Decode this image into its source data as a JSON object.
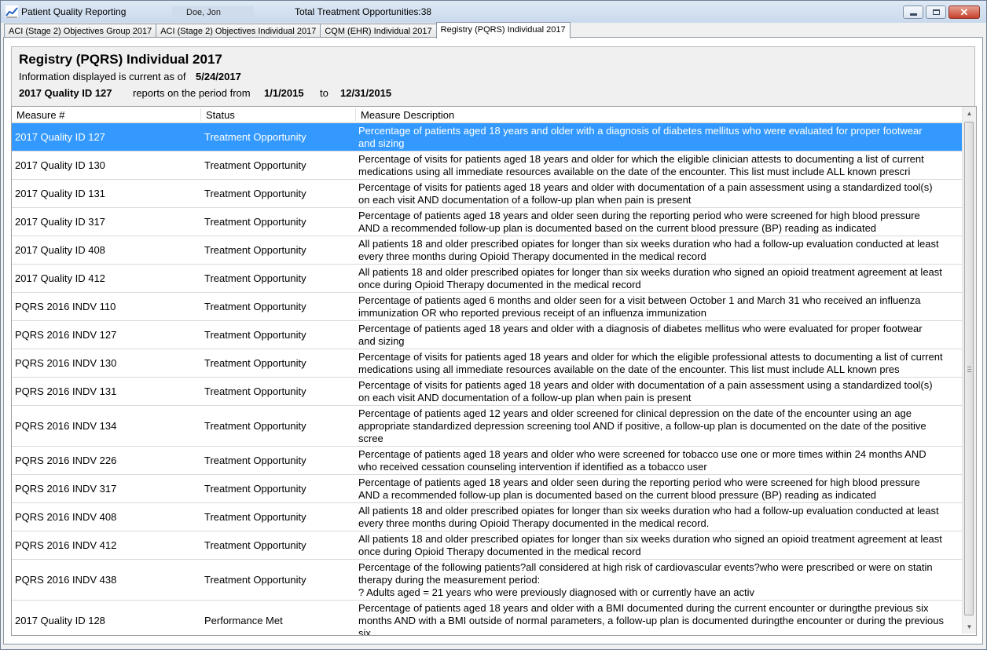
{
  "window": {
    "title": "Patient Quality Reporting",
    "patient_name": "Doe, Jon",
    "opportunities": "Total Treatment Opportunities:38"
  },
  "tabs": [
    {
      "label": "ACI (Stage 2) Objectives Group 2017",
      "active": false
    },
    {
      "label": "ACI (Stage 2) Objectives Individual 2017",
      "active": false
    },
    {
      "label": "CQM (EHR) Individual 2017",
      "active": false
    },
    {
      "label": "Registry (PQRS) Individual 2017",
      "active": true
    }
  ],
  "header": {
    "title": "Registry (PQRS) Individual 2017",
    "asof_label": "Information displayed is current as of",
    "asof_date": "5/24/2017",
    "selected_measure": "2017 Quality ID 127",
    "period_label": "reports on the period from",
    "period_from": "1/1/2015",
    "period_to_label": "to",
    "period_to": "12/31/2015"
  },
  "grid": {
    "columns": [
      "Measure #",
      "Status",
      "Measure Description"
    ],
    "rows": [
      {
        "measure": "2017 Quality ID 127",
        "status": "Treatment Opportunity",
        "selected": true,
        "desc": [
          "Percentage of patients aged 18 years and older with a diagnosis of diabetes mellitus who were evaluated for proper footwear",
          "and sizing"
        ]
      },
      {
        "measure": "2017 Quality ID 130",
        "status": "Treatment Opportunity",
        "desc": [
          "Percentage of visits for patients aged 18 years and older for which the eligible clinician attests to documenting a list of current",
          "medications using all immediate resources available on the date of the encounter. This list must include ALL known prescri"
        ]
      },
      {
        "measure": "2017 Quality ID 131",
        "status": "Treatment Opportunity",
        "desc": [
          "Percentage of visits for patients aged 18 years and older with documentation of a pain assessment using a standardized tool(s)",
          "on each visit AND documentation of a follow-up plan when pain is present"
        ]
      },
      {
        "measure": "2017 Quality ID 317",
        "status": "Treatment Opportunity",
        "desc": [
          "Percentage of patients aged 18 years and older seen during the reporting period who were screened for high blood pressure",
          "AND a recommended follow-up plan is documented based on the current blood pressure (BP) reading as indicated"
        ]
      },
      {
        "measure": "2017 Quality ID 408",
        "status": "Treatment Opportunity",
        "desc": [
          "All patients 18 and older prescribed opiates for longer than six weeks duration who had a follow-up evaluation conducted at least",
          "every three months during Opioid Therapy documented in the medical record"
        ]
      },
      {
        "measure": "2017 Quality ID 412",
        "status": "Treatment Opportunity",
        "desc": [
          "All patients 18 and older prescribed opiates for longer than six weeks duration who signed an opioid treatment agreement at least",
          "once during Opioid Therapy documented in the medical record"
        ]
      },
      {
        "measure": "PQRS 2016 INDV 110",
        "status": "Treatment Opportunity",
        "desc": [
          "Percentage of patients aged 6 months and older seen for a visit between October 1 and March 31 who received an influenza",
          "immunization OR who reported previous receipt of an influenza immunization"
        ]
      },
      {
        "measure": "PQRS 2016 INDV 127",
        "status": "Treatment Opportunity",
        "desc": [
          "Percentage of patients aged 18 years and older with a diagnosis of diabetes mellitus who were evaluated for proper footwear",
          "and sizing"
        ]
      },
      {
        "measure": "PQRS 2016 INDV 130",
        "status": "Treatment Opportunity",
        "desc": [
          "Percentage of visits for patients aged 18 years and older for which the eligible professional attests to documenting a list of current",
          "medications using all immediate resources available on the date of the encounter. This list must include ALL known pres"
        ]
      },
      {
        "measure": "PQRS 2016 INDV 131",
        "status": "Treatment Opportunity",
        "desc": [
          "Percentage of visits for patients aged 18 years and older with documentation of a pain assessment using a standardized tool(s)",
          "on each visit AND documentation of a follow-up plan when pain is present"
        ]
      },
      {
        "measure": "PQRS 2016 INDV 134",
        "status": "Treatment Opportunity",
        "desc": [
          "Percentage of patients aged 12 years and older screened for clinical depression on the date of the encounter using an age",
          "appropriate standardized depression screening tool AND if positive, a follow-up plan is documented on the date of the positive",
          "scree"
        ]
      },
      {
        "measure": "PQRS 2016 INDV 226",
        "status": "Treatment Opportunity",
        "desc": [
          "Percentage of patients aged 18 years and older who were screened for tobacco use one or more times within 24 months AND",
          "who received cessation counseling intervention if identified as a tobacco user"
        ]
      },
      {
        "measure": "PQRS 2016 INDV 317",
        "status": "Treatment Opportunity",
        "desc": [
          "Percentage of patients aged 18 years and older seen during the reporting period who were screened for high blood pressure",
          "AND a recommended follow-up plan is documented based on the current blood pressure (BP) reading as indicated"
        ]
      },
      {
        "measure": "PQRS 2016 INDV 408",
        "status": "Treatment Opportunity",
        "desc": [
          "All patients 18 and older prescribed opiates for longer than six weeks duration who had a follow-up evaluation conducted at least",
          "every three months during Opioid Therapy documented in the medical record."
        ]
      },
      {
        "measure": "PQRS 2016 INDV 412",
        "status": "Treatment Opportunity",
        "desc": [
          "All patients 18 and older prescribed opiates for longer than six weeks duration who signed an opioid treatment agreement at least",
          "once during Opioid Therapy documented in the medical record"
        ]
      },
      {
        "measure": "PQRS 2016 INDV 438",
        "status": "Treatment Opportunity",
        "desc": [
          "Percentage of the following patients?all considered at high risk of cardiovascular events?who were prescribed or were on statin",
          "therapy during the measurement period:",
          "? Adults aged = 21 years who were previously diagnosed with or currently have an activ"
        ]
      },
      {
        "measure": "2017 Quality ID 128",
        "status": "Performance Met",
        "desc": [
          "Percentage of patients aged 18 years and older with a BMI documented during the current encounter or duringthe previous six",
          "months AND with a BMI outside of normal parameters, a follow-up plan is documented duringthe encounter or during the previous",
          "six"
        ]
      }
    ]
  },
  "colors": {
    "selection": "#3399ff",
    "title_bar": "#c9d9ec",
    "close_button": "#c7412c"
  },
  "icons": [
    "chart-icon",
    "minimize-icon",
    "maximize-icon",
    "close-icon",
    "scroll-up-icon",
    "scroll-down-icon"
  ]
}
